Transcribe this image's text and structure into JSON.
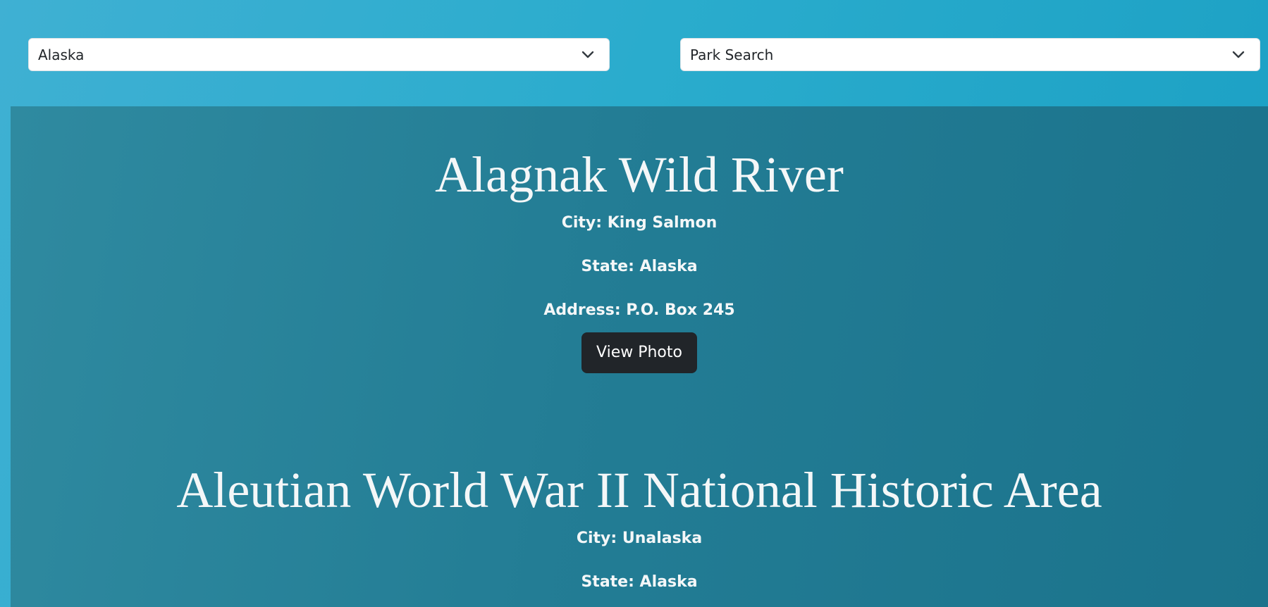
{
  "filters": {
    "state_select": {
      "value": "Alaska",
      "icon": "chevron-down-icon"
    },
    "park_select": {
      "value": "Park Search",
      "icon": "chevron-down-icon"
    }
  },
  "colors": {
    "background": "#2aaccd",
    "panel": "#237d95",
    "button": "#212529",
    "text": "#f4f7f8"
  },
  "parks": [
    {
      "name": "Alagnak Wild River",
      "city": "City: King Salmon",
      "state": "State: Alaska",
      "address": "Address: P.O. Box 245",
      "button_label": "View Photo"
    },
    {
      "name": "Aleutian World War II National Historic Area",
      "city": "City: Unalaska",
      "state": "State: Alaska"
    }
  ]
}
